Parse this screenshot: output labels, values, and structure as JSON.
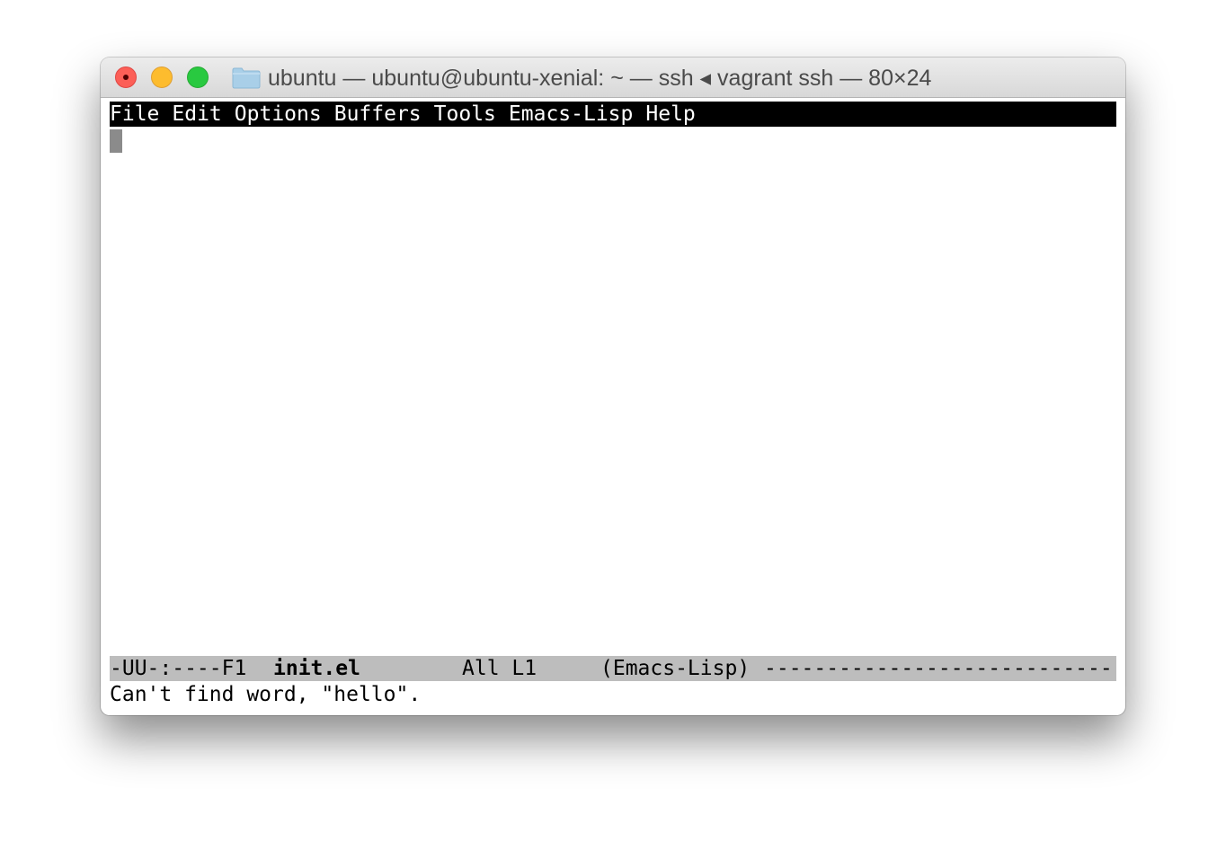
{
  "window": {
    "title": "ubuntu — ubuntu@ubuntu-xenial: ~ — ssh ◂ vagrant ssh — 80×24"
  },
  "menubar": {
    "items": [
      "File",
      "Edit",
      "Options",
      "Buffers",
      "Tools",
      "Emacs-Lisp",
      "Help"
    ]
  },
  "modeline": {
    "status": "-UU-:----F1",
    "buffer_name": "init.el",
    "position": "All L1",
    "mode": "(Emacs-Lisp)",
    "fill": "----------------------------"
  },
  "echo_area": {
    "message": "Can't find word, \"hello\"."
  }
}
